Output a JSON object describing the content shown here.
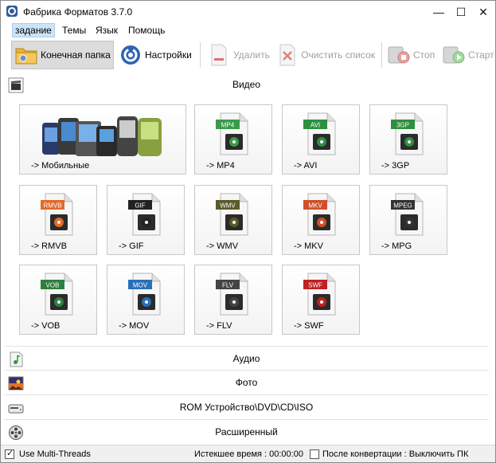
{
  "window": {
    "title": "Фабрика Форматов 3.7.0",
    "controls": {
      "minimize": "—",
      "maximize": "☐",
      "close": "✕"
    }
  },
  "menu": [
    "задание",
    "Темы",
    "Язык",
    "Помощь"
  ],
  "toolbar": {
    "output_folder": "Конечная папка",
    "settings": "Настройки",
    "remove": "Удалить",
    "clear_list": "Очистить список",
    "stop": "Стоп",
    "start": "Старт"
  },
  "categories": {
    "video": "Видео",
    "audio": "Аудио",
    "photo": "Фото",
    "rom": "ROM Устройство\\DVD\\CD\\ISO",
    "advanced": "Расширенный"
  },
  "video_tiles": [
    {
      "label": "-> Мобильные",
      "badge": "",
      "color": "#4a7fb8"
    },
    {
      "label": "-> MP4",
      "badge": "MP4",
      "color": "#3a9a4a"
    },
    {
      "label": "-> AVI",
      "badge": "AVI",
      "color": "#2f8f3f"
    },
    {
      "label": "-> 3GP",
      "badge": "3GP",
      "color": "#2f8f3f"
    },
    {
      "label": "-> RMVB",
      "badge": "RMVB",
      "color": "#e06a2a"
    },
    {
      "label": "-> GIF",
      "badge": "GIF",
      "color": "#222222"
    },
    {
      "label": "-> WMV",
      "badge": "WMV",
      "color": "#5a5a2a"
    },
    {
      "label": "-> MKV",
      "badge": "MKV",
      "color": "#d0502a"
    },
    {
      "label": "-> MPG",
      "badge": "MPEG",
      "color": "#333333"
    },
    {
      "label": "-> VOB",
      "badge": "VOB",
      "color": "#2f7f3f"
    },
    {
      "label": "-> MOV",
      "badge": "MOV",
      "color": "#2a6fb8"
    },
    {
      "label": "-> FLV",
      "badge": "FLV",
      "color": "#444444"
    },
    {
      "label": "-> SWF",
      "badge": "SWF",
      "color": "#c02020"
    }
  ],
  "status": {
    "multithreads": "Use Multi-Threads",
    "multithreads_checked": true,
    "elapsed": "Истекшее время : 00:00:00",
    "after_convert": "После конвертации : Выключить ПК",
    "after_convert_checked": false
  }
}
